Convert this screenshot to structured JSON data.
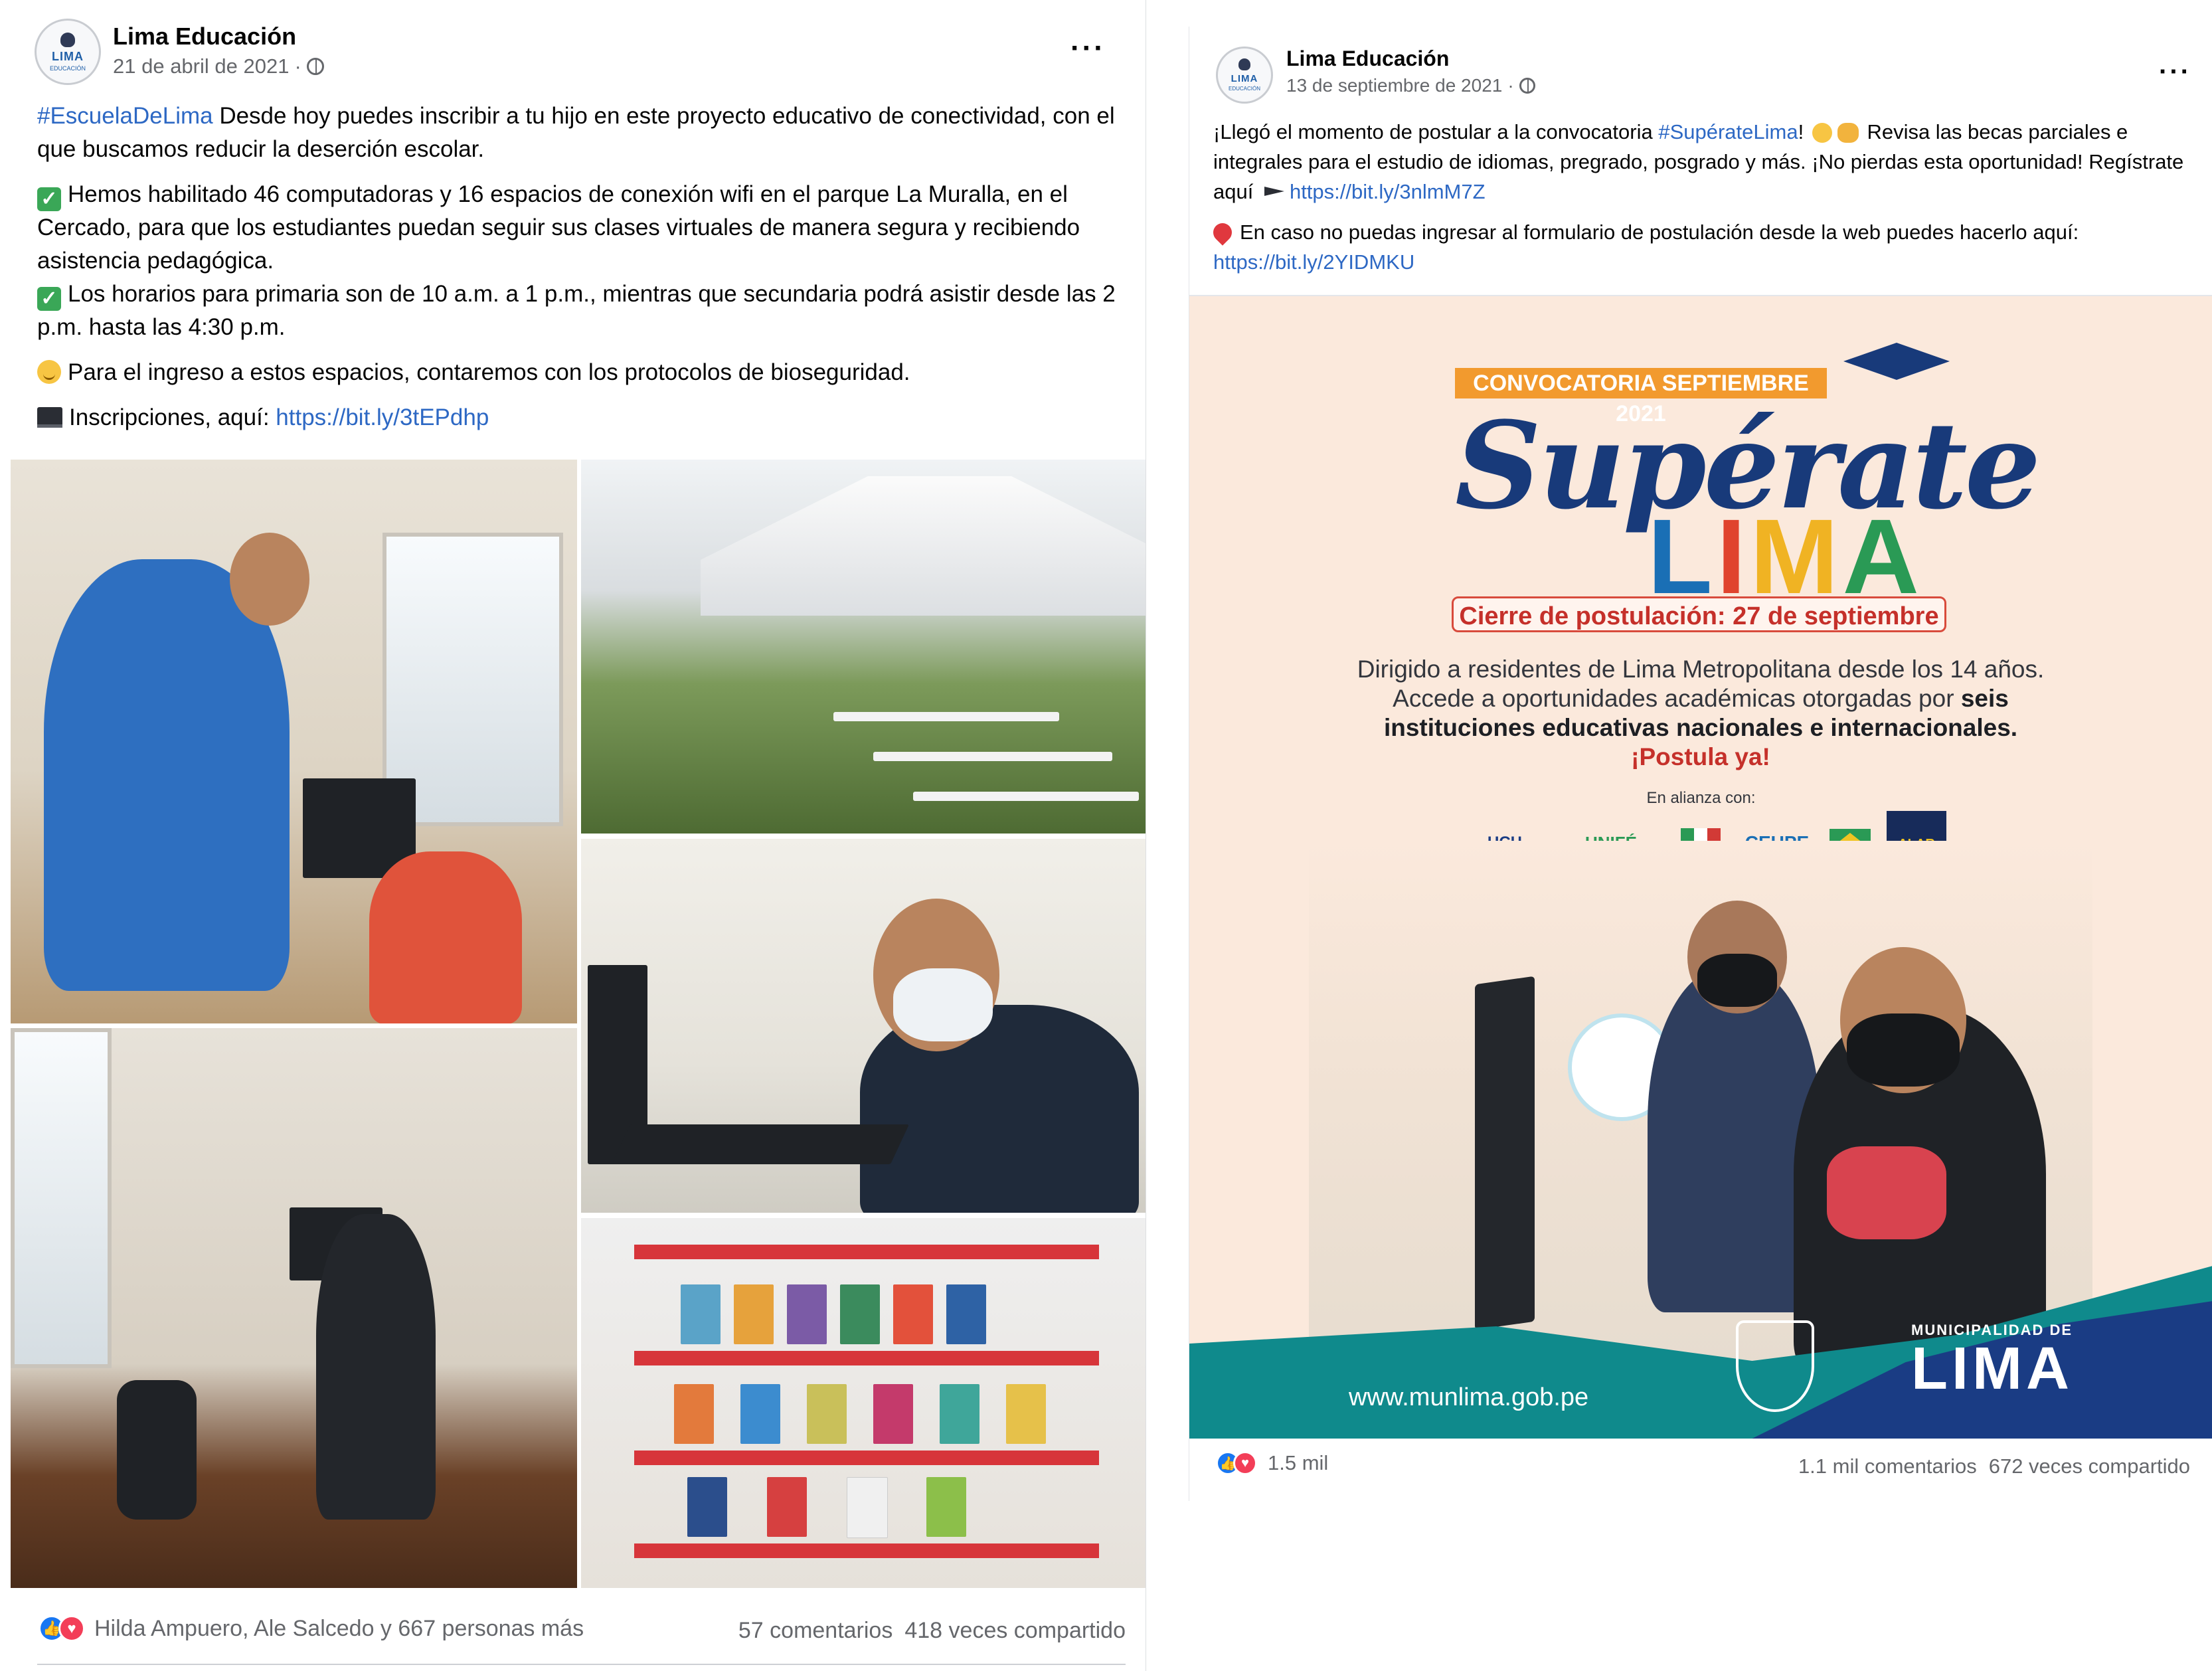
{
  "post1": {
    "page_name": "Lima Educación",
    "avatar_text": "LIMA",
    "avatar_sub": "EDUCACIÓN",
    "date": "21 de abril de 2021",
    "more": "···",
    "p1_tag": "#EscuelaDeLima",
    "p1_text": " Desde hoy puedes inscribir a tu hijo en este proyecto educativo de conectividad, con el que buscamos reducir la deserción escolar.",
    "p2": "Hemos habilitado 46 computadoras y 16 espacios de conexión wifi en el parque La Muralla, en el Cercado, para que los estudiantes puedan seguir sus clases virtuales de manera segura y recibiendo asistencia pedagógica.",
    "p3": "Los horarios para primaria son de 10 a.m. a 1 p.m., mientras que secundaria podrá asistir desde las 2 p.m. hasta las 4:30 p.m.",
    "p4": "Para el ingreso a estos espacios, contaremos con los protocolos de bioseguridad.",
    "p5_text": "Inscripciones, aquí: ",
    "p5_link": "https://bit.ly/3tEPdhp",
    "reactions_text": "Hilda Ampuero, Ale Salcedo y 667 personas más",
    "comments": "57 comentarios",
    "shares": "418 veces compartido"
  },
  "post2": {
    "page_name": "Lima Educación",
    "avatar_text": "LIMA",
    "avatar_sub": "EDUCACIÓN",
    "date": "13 de septiembre de 2021",
    "more": "···",
    "p1_a": "¡Llegó el momento de postular a la convocatoria ",
    "p1_tag": "#SupérateLima",
    "p1_b": "! ",
    "p1_c": " Revisa las becas parciales e integrales para el estudio de idiomas, pregrado, posgrado y más. ¡No pierdas esta oportunidad! Regístrate aquí ",
    "p1_link": "https://bit.ly/3nlmM7Z",
    "p2_text": "En caso no puedas ingresar al formulario de postulación desde la web puedes hacerlo aquí: ",
    "p2_link": "https://bit.ly/2YIDMKU",
    "reactions_count": "1.5 mil",
    "comments": "1.1 mil comentarios",
    "shares": "672 veces compartido"
  },
  "poster": {
    "convocatoria": "CONVOCATORIA SEPTIEMBRE 2021",
    "title_script": "Supérate",
    "title_lima": [
      "L",
      "I",
      "M",
      "A"
    ],
    "lima_colors": [
      "#1a6fb5",
      "#e0432d",
      "#f0b323",
      "#2a9a55"
    ],
    "cierre": "Cierre de postulación: 27 de septiembre",
    "line1": "Dirigido a residentes de Lima Metropolitana desde los 14 años.",
    "line2_a": "Accede a oportunidades académicas otorgadas por ",
    "line2_b": "seis",
    "line3": "instituciones educativas nacionales e internacionales.",
    "postula": "¡Postula ya!",
    "alianza": "En alianza con:",
    "partners": [
      "UCH",
      "UNIFÉ",
      "",
      "CEUPE",
      "",
      "ALAR"
    ],
    "website": "www.munlima.gob.pe",
    "muni_small": "MUNICIPALIDAD DE",
    "muni_big": "LIMA"
  }
}
